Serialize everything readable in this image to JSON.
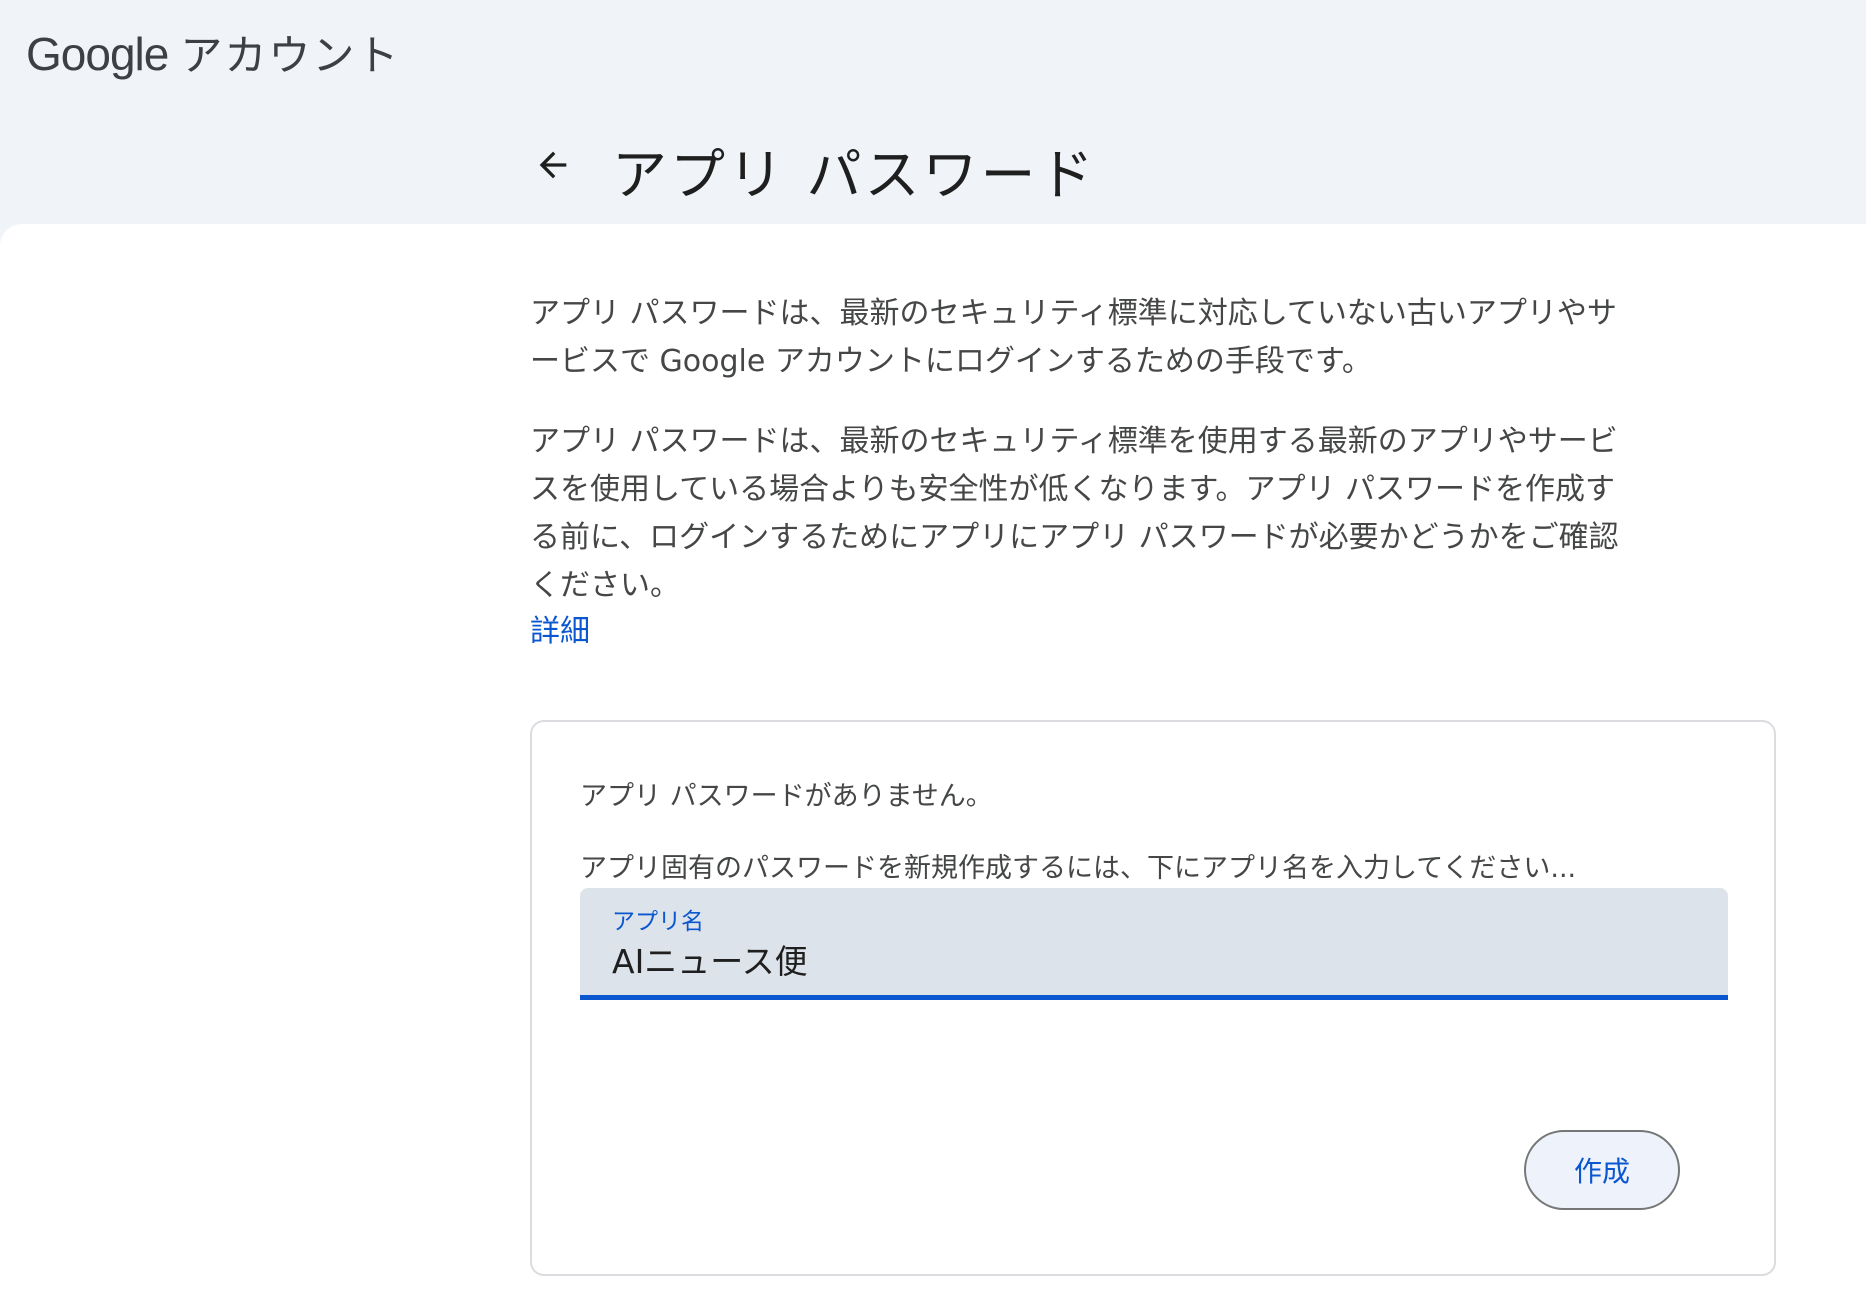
{
  "header": {
    "brand_google": "Google",
    "brand_account": "アカウント"
  },
  "page": {
    "title": "アプリ パスワード"
  },
  "description": {
    "paragraph1": "アプリ パスワードは、最新のセキュリティ標準に対応していない古いアプリやサービスで Google アカウントにログインするための手段です。",
    "paragraph2": "アプリ パスワードは、最新のセキュリティ標準を使用する最新のアプリやサービスを使用している場合よりも安全性が低くなります。アプリ パスワードを作成する前に、ログインするためにアプリにアプリ パスワードが必要かどうかをご確認ください。",
    "details_link": "詳細"
  },
  "card": {
    "no_passwords": "アプリ パスワードがありません。",
    "instruction": "アプリ固有のパスワードを新規作成するには、下にアプリ名を入力してください...",
    "field_label": "アプリ名",
    "field_value": "AIニュース便",
    "create_label": "作成"
  },
  "colors": {
    "header_bg": "#f0f4f9",
    "accent": "#0b57d0",
    "field_bg": "#dde3ea"
  },
  "icons": {
    "back": "arrow-back-icon"
  }
}
